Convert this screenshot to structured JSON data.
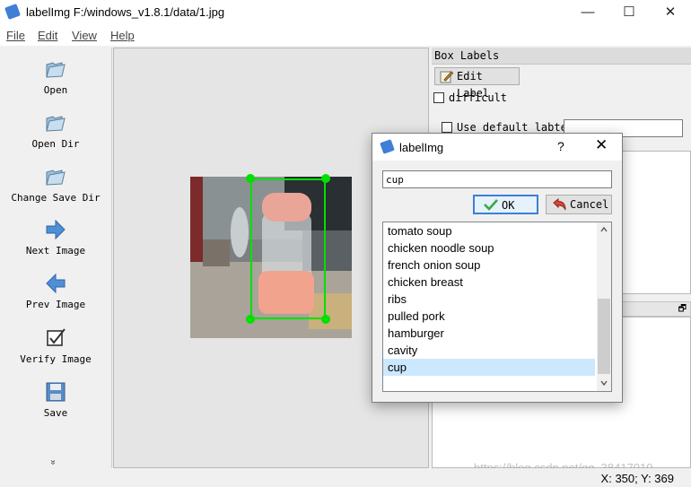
{
  "window": {
    "title": "labelImg F:/windows_v1.8.1/data/1.jpg",
    "minimize": "—",
    "maximize": "☐",
    "close": "✕"
  },
  "menu": [
    "File",
    "Edit",
    "View",
    "Help"
  ],
  "toolbar": [
    {
      "label": "Open",
      "icon": "folder-open-icon"
    },
    {
      "label": "Open Dir",
      "icon": "folder-open-icon"
    },
    {
      "label": "Change Save Dir",
      "icon": "folder-open-icon"
    },
    {
      "label": "Next Image",
      "icon": "arrow-right-icon"
    },
    {
      "label": "Prev Image",
      "icon": "arrow-left-icon"
    },
    {
      "label": "Verify Image",
      "icon": "checkbox-icon"
    },
    {
      "label": "Save",
      "icon": "floppy-disk-icon"
    }
  ],
  "toolbar_more": "»",
  "box_labels": {
    "header": "Box Labels",
    "edit_label": "Edit Label",
    "difficult": "difficult",
    "use_default": "Use default labtel",
    "default_value": ""
  },
  "dock2_float": "🗗",
  "dialog": {
    "title": "labelImg",
    "help": "?",
    "close": "✕",
    "input_value": "cup",
    "ok": "OK",
    "cancel": "Cancel",
    "items": [
      "tomato soup",
      "chicken noodle soup",
      "french onion soup",
      "chicken breast",
      "ribs",
      "pulled pork",
      "hamburger",
      "cavity",
      "cup"
    ],
    "selected": "cup"
  },
  "status": {
    "coords": "X: 350; Y: 369"
  },
  "watermark": "https://blog.csdn.net/qq_38417010",
  "colors": {
    "bbox": "#00e000",
    "selection": "#cce8ff",
    "ok_border": "#3c7fd6"
  }
}
